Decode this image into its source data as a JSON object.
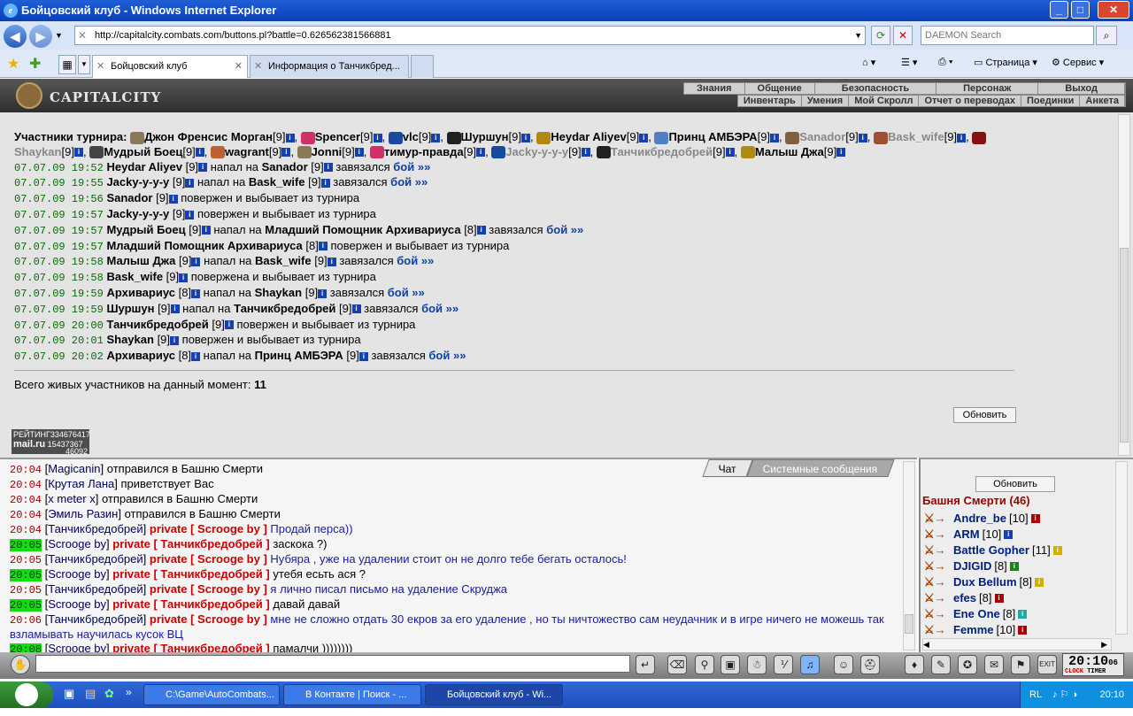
{
  "window": {
    "title": "Бойцовский клуб - Windows Internet Explorer"
  },
  "address": {
    "url": "http://capitalcity.combats.com/buttons.pl?battle=0.626562381566881",
    "search_placeholder": "DAEMON Search"
  },
  "tabs": [
    {
      "label": "Бойцовский клуб"
    },
    {
      "label": "Информация о Танчикбред..."
    }
  ],
  "toolbar": {
    "page": "Страница",
    "service": "Сервис"
  },
  "game": {
    "logo": "CAPITALCITY",
    "nav1": [
      "Знания",
      "Общение",
      "Безопасность",
      "Персонаж",
      "Выход"
    ],
    "nav2": [
      "Инвентарь",
      "Умения",
      "Мой Скролл",
      "Отчет о переводах",
      "Поединки",
      "Анкета"
    ]
  },
  "tournament": {
    "participants_label": "Участники турнира:",
    "participants": [
      {
        "name": "Джон Френсис Морган",
        "lvl": "[9]",
        "dead": false
      },
      {
        "name": "Spencer",
        "lvl": "[9]",
        "dead": false
      },
      {
        "name": "vlc",
        "lvl": "[9]",
        "dead": false
      },
      {
        "name": "Шуршун",
        "lvl": "[9]",
        "dead": false
      },
      {
        "name": "Heydar Aliyev",
        "lvl": "[9]",
        "dead": false
      },
      {
        "name": "Принц АМБЭРА",
        "lvl": "[9]",
        "dead": false
      },
      {
        "name": "Sanador",
        "lvl": "[9]",
        "dead": true
      },
      {
        "name": "Bask_wife",
        "lvl": "[9]",
        "dead": true
      },
      {
        "name": "Shaykan",
        "lvl": "[9]",
        "dead": true
      },
      {
        "name": "Мудрый Боец",
        "lvl": "[9]",
        "dead": false
      },
      {
        "name": "wagrant",
        "lvl": "[9]",
        "dead": false
      },
      {
        "name": "Jonni",
        "lvl": "[9]",
        "dead": false
      },
      {
        "name": "тимур-правда",
        "lvl": "[9]",
        "dead": false
      },
      {
        "name": "Jacky-у-у-у",
        "lvl": "[9]",
        "dead": true
      },
      {
        "name": "Танчикбредобрей",
        "lvl": "[9]",
        "dead": true
      },
      {
        "name": "Малыш Джа",
        "lvl": "[9]",
        "dead": false
      }
    ],
    "log": [
      {
        "time": "07.07.09 19:52",
        "a": "Heydar Aliyev",
        "al": "[9]",
        "verb": "напал на",
        "b": "Sanador",
        "bl": "[9]",
        "end": "завязался",
        "fight": "бой »»"
      },
      {
        "time": "07.07.09 19:55",
        "a": "Jacky-у-у-у",
        "al": "[9]",
        "verb": "напал на",
        "b": "Bask_wife",
        "bl": "[9]",
        "end": "завязался",
        "fight": "бой »»"
      },
      {
        "time": "07.07.09 19:56",
        "a": "Sanador",
        "al": "[9]",
        "verb": "повержен и выбывает из турнира",
        "b": "",
        "bl": "",
        "end": "",
        "fight": ""
      },
      {
        "time": "07.07.09 19:57",
        "a": "Jacky-у-у-у",
        "al": "[9]",
        "verb": "повержен и выбывает из турнира",
        "b": "",
        "bl": "",
        "end": "",
        "fight": ""
      },
      {
        "time": "07.07.09 19:57",
        "a": "Мудрый Боец",
        "al": "[9]",
        "verb": "напал на",
        "b": "Младший Помощник Архивариуса",
        "bl": "[8]",
        "end": "завязался",
        "fight": "бой »»"
      },
      {
        "time": "07.07.09 19:57",
        "a": "Младший Помощник Архивариуса",
        "al": "[8]",
        "verb": "повержен и выбывает из турнира",
        "b": "",
        "bl": "",
        "end": "",
        "fight": ""
      },
      {
        "time": "07.07.09 19:58",
        "a": "Малыш Джа",
        "al": "[9]",
        "verb": "напал на",
        "b": "Bask_wife",
        "bl": "[9]",
        "end": "завязался",
        "fight": "бой »»"
      },
      {
        "time": "07.07.09 19:58",
        "a": "Bask_wife",
        "al": "[9]",
        "verb": "повержена и выбывает из турнира",
        "b": "",
        "bl": "",
        "end": "",
        "fight": ""
      },
      {
        "time": "07.07.09 19:59",
        "a": "Архивариус",
        "al": "[8]",
        "verb": "напал на",
        "b": "Shaykan",
        "bl": "[9]",
        "end": "завязался",
        "fight": "бой »»"
      },
      {
        "time": "07.07.09 19:59",
        "a": "Шуршун",
        "al": "[9]",
        "verb": "напал на",
        "b": "Танчикбредобрей",
        "bl": "[9]",
        "end": "завязался",
        "fight": "бой »»"
      },
      {
        "time": "07.07.09 20:00",
        "a": "Танчикбредобрей",
        "al": "[9]",
        "verb": "повержен и выбывает из турнира",
        "b": "",
        "bl": "",
        "end": "",
        "fight": ""
      },
      {
        "time": "07.07.09 20:01",
        "a": "Shaykan",
        "al": "[9]",
        "verb": "повержен и выбывает из турнира",
        "b": "",
        "bl": "",
        "end": "",
        "fight": ""
      },
      {
        "time": "07.07.09 20:02",
        "a": "Архивариус",
        "al": "[8]",
        "verb": "напал на",
        "b": "Принц АМБЭРА",
        "bl": "[9]",
        "end": "завязался",
        "fight": "бой »»"
      }
    ],
    "alive_label": "Всего живых участников на данный момент:",
    "alive_count": "11",
    "refresh": "Обновить",
    "rating": {
      "label": "РЕЙТИНГ",
      "n1": "334676417",
      "n2": "15437367",
      "n3": "46092",
      "brand": "mail.ru"
    }
  },
  "chat": {
    "tabs": [
      "Чат",
      "Системные сообщения"
    ],
    "lines": [
      {
        "time": "20:04",
        "green": false,
        "name": "Magicanin",
        "priv": "",
        "text": "отправился в Башню Смерти",
        "p": false
      },
      {
        "time": "20:04",
        "green": false,
        "name": "Крутая Лана",
        "priv": "",
        "text": "приветствует Вас",
        "p": false
      },
      {
        "time": "20:04",
        "green": false,
        "name": "x meter x",
        "priv": "",
        "text": "отправился в Башню Смерти",
        "p": false
      },
      {
        "time": "20:04",
        "green": false,
        "name": "Эмиль Разин",
        "priv": "",
        "text": "отправился в Башню Смерти",
        "p": false
      },
      {
        "time": "20:04",
        "green": false,
        "name": "Танчикбредобрей",
        "priv": "private [ Scrooge by ]",
        "text": "Продай перса))",
        "p": true
      },
      {
        "time": "20:05",
        "green": true,
        "name": "Scrooge by",
        "priv": "private [ Танчикбредобрей ]",
        "text": "заскока ?)",
        "p": false
      },
      {
        "time": "20:05",
        "green": false,
        "name": "Танчикбредобрей",
        "priv": "private [ Scrooge by ]",
        "text": "Нубяра , уже на удалении стоит он не долго тебе бегать осталось!",
        "p": true
      },
      {
        "time": "20:05",
        "green": true,
        "name": "Scrooge by",
        "priv": "private [ Танчикбредобрей ]",
        "text": "утебя есьть ася ?",
        "p": false
      },
      {
        "time": "20:05",
        "green": false,
        "name": "Танчикбредобрей",
        "priv": "private [ Scrooge by ]",
        "text": "я лично писал письмо на удаление Скруджа",
        "p": true
      },
      {
        "time": "20:05",
        "green": true,
        "name": "Scrooge by",
        "priv": "private [ Танчикбредобрей ]",
        "text": "давай давай",
        "p": false
      },
      {
        "time": "20:06",
        "green": false,
        "name": "Танчикбредобрей",
        "priv": "private [ Scrooge by ]",
        "text": "мне не сложно отдать 30 екров за его удаление , но ты ничтожество сам неудачник и в игре ничего не можешь так взламывать научилась кусок ВЦ",
        "p": true
      },
      {
        "time": "20:08",
        "green": true,
        "name": "Scrooge by",
        "priv": "private [ Танчикбредобрей ]",
        "text": "памалчи ))))))))",
        "p": false
      }
    ]
  },
  "room": {
    "refresh": "Обновить",
    "title": "Башня Смерти (46)",
    "players": [
      {
        "name": "Andre_be",
        "lvl": "[10]"
      },
      {
        "name": "ARM",
        "lvl": "[10]"
      },
      {
        "name": "Battle Gopher",
        "lvl": "[11]"
      },
      {
        "name": "DJIGID",
        "lvl": "[8]"
      },
      {
        "name": "Dux Bellum",
        "lvl": "[8]"
      },
      {
        "name": "efes",
        "lvl": "[8]"
      },
      {
        "name": "Ene One",
        "lvl": "[8]"
      },
      {
        "name": "Femme",
        "lvl": "[10]"
      }
    ]
  },
  "clock": {
    "time": "20:10",
    "sec": "06",
    "label": "CLOCK",
    "timer": "TIMER"
  },
  "taskbar": {
    "start": "start",
    "items": [
      {
        "label": "C:\\Game\\AutoCombats..."
      },
      {
        "label": "В Контакте | Поиск - ..."
      },
      {
        "label": "Бойцовский клуб - Wi..."
      }
    ],
    "lang": "RL",
    "time": "20:10"
  }
}
